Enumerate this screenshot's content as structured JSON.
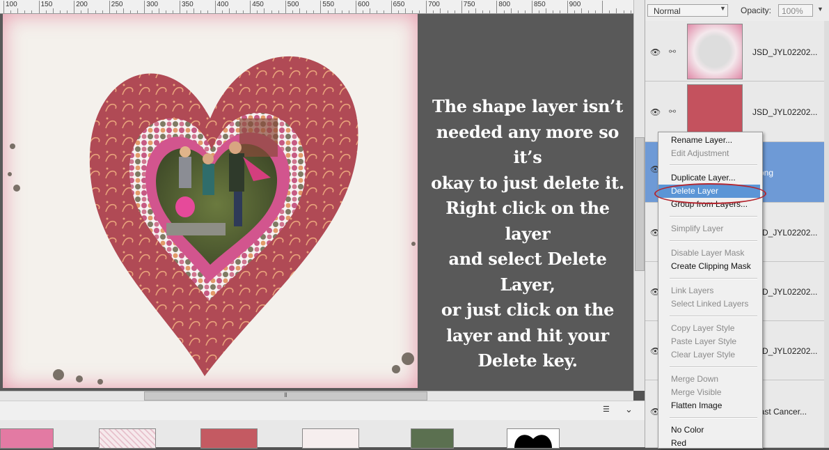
{
  "ruler": {
    "labels": [
      "100",
      "150",
      "200",
      "250",
      "300",
      "350",
      "400",
      "450",
      "500",
      "550",
      "600",
      "650",
      "700",
      "750",
      "800",
      "850",
      "900"
    ]
  },
  "canvas": {
    "instruction": "The shape layer isn’t needed any more so it’s okay to just delete it. Right click on the layer and select Delete Layer, or just click on the layer and hit your Delete key.",
    "instruction_lines": [
      "The shape layer isn’t",
      "needed any more so it’s",
      "okay to just delete it.",
      "Right click on the layer",
      "and select Delete Layer,",
      "or just click on the",
      "layer and hit your",
      "Delete key."
    ],
    "hscroll_grip": "Ⅱ"
  },
  "layers_panel": {
    "blend_mode": "Normal",
    "opacity_label": "Opacity:",
    "opacity_value": "100%",
    "layers": [
      {
        "name": "JSD_JYL02202...",
        "selected": false
      },
      {
        "name": "JSD_JYL02202...",
        "selected": false
      },
      {
        "name": "e.png",
        "selected": true
      },
      {
        "name": "JSD_JYL02202...",
        "selected": false
      },
      {
        "name": "JSD_JYL02202...",
        "selected": false
      },
      {
        "name": "JSD_JYL02202...",
        "selected": false
      },
      {
        "name": "reast Cancer...",
        "selected": false
      }
    ]
  },
  "context_menu": {
    "items": [
      {
        "label": "Rename Layer...",
        "enabled": true
      },
      {
        "label": "Edit Adjustment",
        "enabled": false
      },
      {
        "label": "Duplicate Layer...",
        "enabled": true
      },
      {
        "label": "Delete Layer",
        "enabled": true,
        "highlighted": true
      },
      {
        "label": "Group from Layers...",
        "enabled": true
      },
      {
        "label": "Simplify Layer",
        "enabled": false
      },
      {
        "label": "Disable Layer Mask",
        "enabled": false
      },
      {
        "label": "Create Clipping Mask",
        "enabled": true
      },
      {
        "label": "Link Layers",
        "enabled": false
      },
      {
        "label": "Select Linked Layers",
        "enabled": false
      },
      {
        "label": "Copy Layer Style",
        "enabled": false
      },
      {
        "label": "Paste Layer Style",
        "enabled": false
      },
      {
        "label": "Clear Layer Style",
        "enabled": false
      },
      {
        "label": "Merge Down",
        "enabled": false
      },
      {
        "label": "Merge Visible",
        "enabled": false
      },
      {
        "label": "Flatten Image",
        "enabled": true
      },
      {
        "label": "No Color",
        "enabled": true
      },
      {
        "label": "Red",
        "enabled": true
      }
    ]
  },
  "colors": {
    "highlight": "#5b95d6",
    "annotation_circle": "#b3262f",
    "heart_outer": "#b04a55",
    "heart_pink": "#d2558e"
  }
}
